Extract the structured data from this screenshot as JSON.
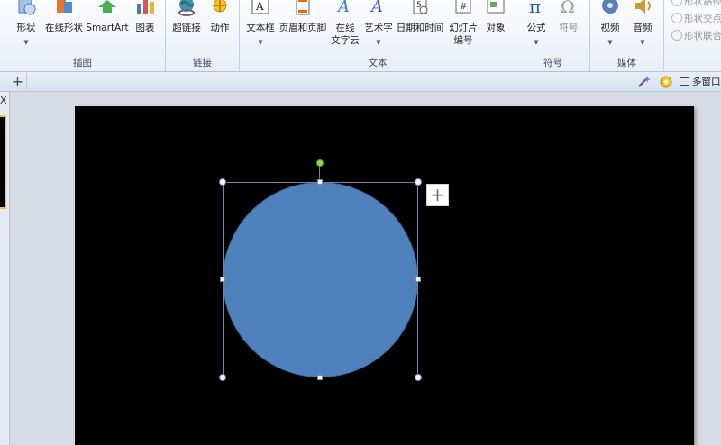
{
  "ribbon": {
    "illustrations": {
      "group_label": "插图",
      "buttons": [
        {
          "label": "形状",
          "icon": "shapes-icon"
        },
        {
          "label": "在线形状",
          "icon": "online-shapes-icon"
        },
        {
          "label": "SmartArt",
          "icon": "smartart-icon"
        },
        {
          "label": "图表",
          "icon": "chart-icon"
        }
      ]
    },
    "links": {
      "group_label": "链接",
      "buttons": [
        {
          "label": "超链接",
          "icon": "hyperlink-icon"
        },
        {
          "label": "动作",
          "icon": "action-icon"
        }
      ]
    },
    "text": {
      "group_label": "文本",
      "buttons": [
        {
          "label": "文本框",
          "icon": "textbox-icon"
        },
        {
          "label": "页眉和页脚",
          "icon": "header-footer-icon"
        },
        {
          "label": "在线",
          "label2": "文字云",
          "icon": "online-wordcloud-icon"
        },
        {
          "label": "艺术字",
          "icon": "wordart-icon"
        },
        {
          "label": "日期和时间",
          "icon": "date-time-icon"
        },
        {
          "label": "幻灯片",
          "label2": "编号",
          "icon": "slide-number-icon"
        },
        {
          "label": "对象",
          "icon": "object-icon"
        }
      ]
    },
    "symbols": {
      "group_label": "符号",
      "buttons": [
        {
          "label": "公式",
          "icon": "equation-icon"
        },
        {
          "label": "符号",
          "icon": "symbol-icon"
        }
      ]
    },
    "media": {
      "group_label": "媒体",
      "buttons": [
        {
          "label": "视频",
          "icon": "video-icon"
        },
        {
          "label": "音频",
          "icon": "audio-icon"
        }
      ]
    },
    "shape_tools": [
      {
        "label": "形状路径"
      },
      {
        "label": "形状交点"
      },
      {
        "label": "形状联合"
      }
    ]
  },
  "tabstrip": {
    "add_label": "+",
    "multiwindow_label": "多窗口"
  },
  "leftpane": {
    "close_label": "X"
  },
  "slide": {
    "layout_button_label": "+"
  },
  "colors": {
    "circle_fill": "#4f81bd",
    "slide_background": "#000000",
    "rotate_handle": "#8fd14f"
  }
}
